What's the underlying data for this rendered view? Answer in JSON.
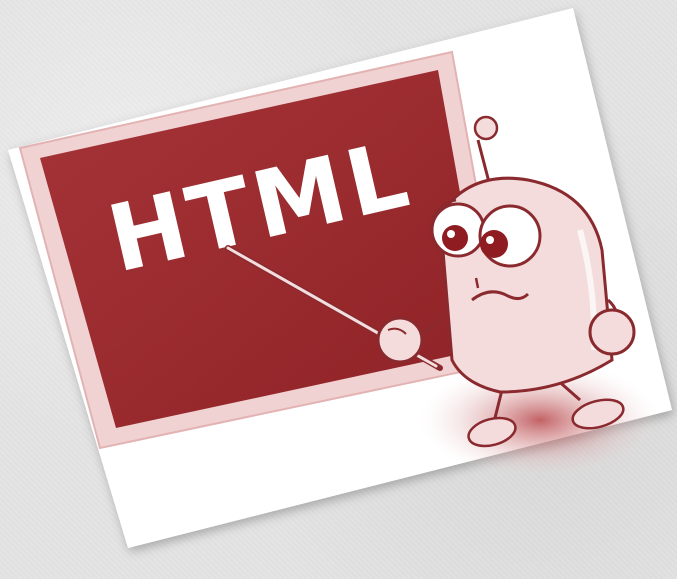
{
  "illustration": {
    "board_text": "HTML",
    "colors": {
      "background": "#e4e4e4",
      "card": "#ffffff",
      "board_frame": "#f0d2d2",
      "board": "#9a2a2e",
      "board_text": "#ffffff",
      "robot_fill": "#f4dcdc",
      "robot_stroke": "#8a2a2e",
      "pointer": "#e8c8c8"
    },
    "icons": {
      "teacher": "robot-teacher-icon",
      "pointer": "pointer-stick-icon"
    }
  }
}
